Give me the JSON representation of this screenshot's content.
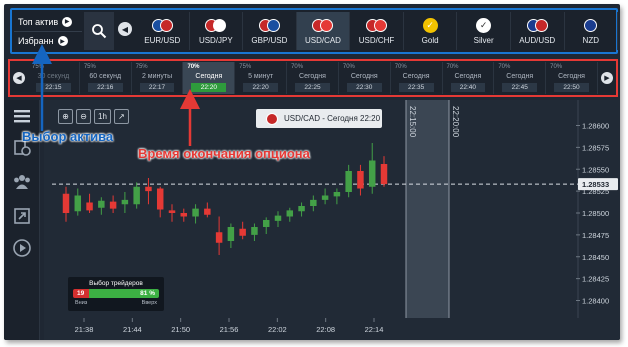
{
  "quick_menu": {
    "top_assets_label": "Топ актив",
    "favorites_label": "Избранн",
    "arrow_glyph": "▶"
  },
  "assets_prev_glyph": "◀",
  "assets": [
    {
      "name": "EUR/USD",
      "flags": [
        "#1a4fa0",
        "#c62828"
      ]
    },
    {
      "name": "USD/JPY",
      "flags": [
        "#c62828",
        "#ffffff"
      ]
    },
    {
      "name": "GBP/USD",
      "flags": [
        "#c62828",
        "#1a4fa0"
      ]
    },
    {
      "name": "USD/CAD",
      "flags": [
        "#c62828",
        "#e53935"
      ],
      "active": true
    },
    {
      "name": "USD/CHF",
      "flags": [
        "#c62828",
        "#e53935"
      ]
    },
    {
      "name": "Gold",
      "coin": {
        "bg": "#f2c200",
        "fg": "#ffffff",
        "glyph": "✓"
      }
    },
    {
      "name": "Silver",
      "coin": {
        "bg": "#ffffff",
        "fg": "#333333",
        "glyph": "✓"
      }
    },
    {
      "name": "AUD/USD",
      "flags": [
        "#1a3c8f",
        "#c62828"
      ]
    },
    {
      "name": "NZD",
      "flags": [
        "#1a3c8f"
      ]
    }
  ],
  "expiry": {
    "prev_glyph": "◀",
    "next_glyph": "▶",
    "items": [
      {
        "pct": "75%",
        "label": "30 секунд",
        "time": "22:15",
        "dim": true
      },
      {
        "pct": "75%",
        "label": "60 секунд",
        "time": "22:16"
      },
      {
        "pct": "75%",
        "label": "2 минуты",
        "time": "22:17"
      },
      {
        "pct": "70%",
        "label": "Сегодня",
        "time": "22:20",
        "active": true
      },
      {
        "pct": "75%",
        "label": "5 минут",
        "time": "22:20"
      },
      {
        "pct": "70%",
        "label": "Сегодня",
        "time": "22:25"
      },
      {
        "pct": "70%",
        "label": "Сегодня",
        "time": "22:30"
      },
      {
        "pct": "70%",
        "label": "Сегодня",
        "time": "22:35"
      },
      {
        "pct": "70%",
        "label": "Сегодня",
        "time": "22:40"
      },
      {
        "pct": "70%",
        "label": "Сегодня",
        "time": "22:45"
      },
      {
        "pct": "70%",
        "label": "Сегодня",
        "time": "22:50"
      }
    ]
  },
  "sidebar_icons": [
    "menu-icon",
    "chart-history-icon",
    "social-traders-icon",
    "fullscreen-icon",
    "play-icon"
  ],
  "chart": {
    "zoom_buttons": [
      "⊕",
      "⊖",
      "1h",
      "↗"
    ],
    "asset_label": "USD/CAD - Сегодня 22:20",
    "expiry_line_1": "22:15:00",
    "expiry_line_2": "22:20:00",
    "current_price": "1.28533",
    "colors": {
      "bull": "#43a047",
      "bear": "#e53935",
      "bg": "#212a36"
    }
  },
  "traders_panel": {
    "title": "Выбор трейдеров",
    "down_value": "19",
    "up_value": "81 %",
    "down_share": 0.19,
    "down_label": "Вниз",
    "up_label": "Вверх"
  },
  "annotations": {
    "asset_choice": "Выбор актива",
    "expiry_time": "Время окончания опциона"
  },
  "chart_data": {
    "type": "candlestick",
    "x_tick_labels": [
      "21:38",
      "21:44",
      "21:50",
      "21:56",
      "22:02",
      "22:08",
      "22:14"
    ],
    "y_tick_labels": [
      "1.28600",
      "1.28575",
      "1.28550",
      "1.28525",
      "1.28500",
      "1.28475",
      "1.28450",
      "1.28425",
      "1.28400"
    ],
    "ylim": [
      1.2838,
      1.2862
    ],
    "current_price": 1.28533,
    "candles": [
      {
        "o": 1.28522,
        "h": 1.2853,
        "l": 1.2849,
        "c": 1.285
      },
      {
        "o": 1.28502,
        "h": 1.28528,
        "l": 1.28497,
        "c": 1.2852
      },
      {
        "o": 1.28512,
        "h": 1.28522,
        "l": 1.285,
        "c": 1.28503
      },
      {
        "o": 1.28506,
        "h": 1.28518,
        "l": 1.28498,
        "c": 1.28514
      },
      {
        "o": 1.28513,
        "h": 1.2852,
        "l": 1.285,
        "c": 1.28505
      },
      {
        "o": 1.2851,
        "h": 1.28524,
        "l": 1.285,
        "c": 1.28515
      },
      {
        "o": 1.2851,
        "h": 1.28535,
        "l": 1.28505,
        "c": 1.2853
      },
      {
        "o": 1.2853,
        "h": 1.2854,
        "l": 1.2851,
        "c": 1.28525
      },
      {
        "o": 1.28528,
        "h": 1.2853,
        "l": 1.28495,
        "c": 1.28504
      },
      {
        "o": 1.28503,
        "h": 1.2851,
        "l": 1.2849,
        "c": 1.285
      },
      {
        "o": 1.285,
        "h": 1.28505,
        "l": 1.2849,
        "c": 1.28496
      },
      {
        "o": 1.28496,
        "h": 1.2851,
        "l": 1.28488,
        "c": 1.28505
      },
      {
        "o": 1.28505,
        "h": 1.28512,
        "l": 1.28495,
        "c": 1.28498
      },
      {
        "o": 1.28478,
        "h": 1.28496,
        "l": 1.28452,
        "c": 1.28466
      },
      {
        "o": 1.28468,
        "h": 1.28488,
        "l": 1.2846,
        "c": 1.28484
      },
      {
        "o": 1.28482,
        "h": 1.2849,
        "l": 1.2847,
        "c": 1.28474
      },
      {
        "o": 1.28475,
        "h": 1.28488,
        "l": 1.28468,
        "c": 1.28484
      },
      {
        "o": 1.28484,
        "h": 1.28495,
        "l": 1.28476,
        "c": 1.28492
      },
      {
        "o": 1.28491,
        "h": 1.28502,
        "l": 1.28484,
        "c": 1.28497
      },
      {
        "o": 1.28496,
        "h": 1.28506,
        "l": 1.2849,
        "c": 1.28503
      },
      {
        "o": 1.28502,
        "h": 1.28512,
        "l": 1.28496,
        "c": 1.28508
      },
      {
        "o": 1.28508,
        "h": 1.2852,
        "l": 1.28502,
        "c": 1.28515
      },
      {
        "o": 1.28515,
        "h": 1.28528,
        "l": 1.2851,
        "c": 1.2852
      },
      {
        "o": 1.28519,
        "h": 1.28528,
        "l": 1.2851,
        "c": 1.28524
      },
      {
        "o": 1.28524,
        "h": 1.28555,
        "l": 1.28518,
        "c": 1.28548
      },
      {
        "o": 1.28548,
        "h": 1.28555,
        "l": 1.2852,
        "c": 1.28528
      },
      {
        "o": 1.2853,
        "h": 1.2858,
        "l": 1.28522,
        "c": 1.2856
      },
      {
        "o": 1.28556,
        "h": 1.28565,
        "l": 1.2853,
        "c": 1.28533
      }
    ]
  }
}
